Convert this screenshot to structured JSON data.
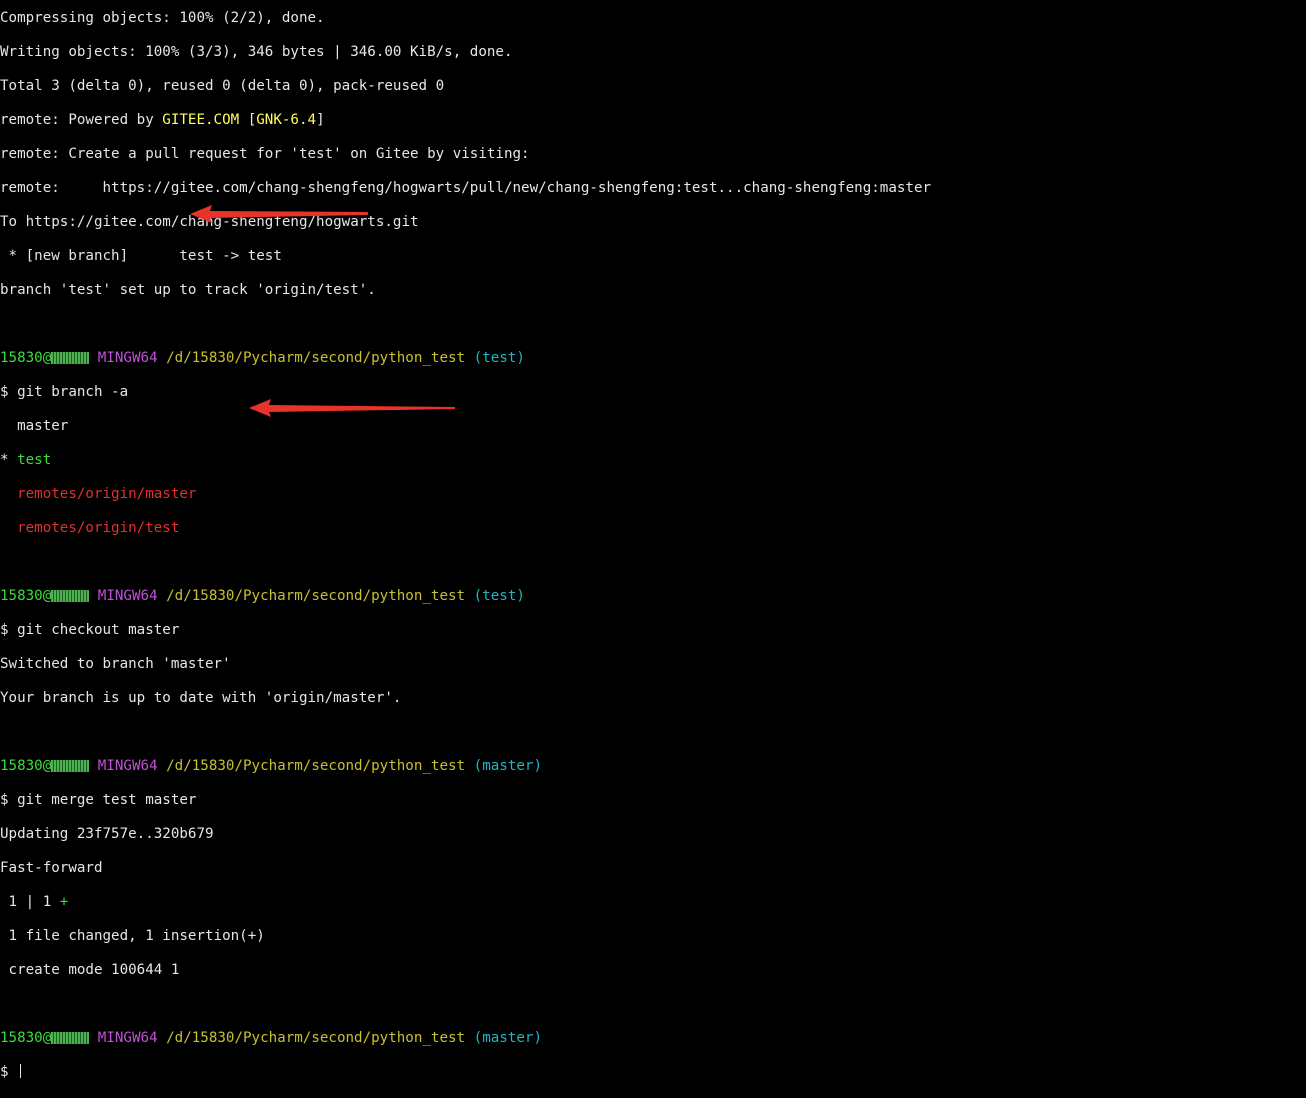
{
  "terminal": {
    "lines": [
      "Compressing objects: 100% (2/2), done.",
      "Writing objects: 100% (3/3), 346 bytes | 346.00 KiB/s, done.",
      "Total 3 (delta 0), reused 0 (delta 0), pack-reused 0",
      "remote: Create a pull request for 'test' on Gitee by visiting:",
      "remote:     https://gitee.com/chang-shengfeng/hogwarts/pull/new/chang-shengfeng:test...chang-shengfeng:master",
      "To https://gitee.com/chang-shengfeng/hogwarts.git",
      " * [new branch]      test -> test",
      "branch 'test' set up to track 'origin/test'.",
      "$ git branch -a",
      "  master",
      "remotes/origin/master",
      "remotes/origin/test",
      "$ git checkout master",
      "Switched to branch 'master'",
      "Your branch is up to date with 'origin/master'.",
      "$ git merge test master",
      "Updating 23f757e..320b679",
      "Fast-forward",
      " 1 file changed, 1 insertion(+)",
      " create mode 100644 1",
      "$ "
    ],
    "remote_powered": {
      "prefix": "remote: Powered by ",
      "brand": "GITEE.COM",
      "open_bracket": " [",
      "version": "GNK-6.4",
      "close_bracket": "]"
    },
    "test_branch": {
      "star": "* ",
      "name": "test"
    },
    "diff_stat": {
      "prefix": " 1 | 1 ",
      "plus": "+"
    },
    "prompt": {
      "user": "15830@",
      "env": "MINGW64",
      "path": "/d/15830/Pycharm/second/python_test",
      "branch_test": "(test)",
      "branch_master": "(master)"
    },
    "colors": {
      "background": "#000000",
      "text": "#e6e6e6",
      "prompt_user": "#3cdc3c",
      "prompt_env": "#c050d8",
      "prompt_path": "#c8c030",
      "prompt_branch": "#1fb6c3",
      "brand": "#ffff5a",
      "remote_branch": "#e03030",
      "arrow": "#e8332a"
    }
  }
}
